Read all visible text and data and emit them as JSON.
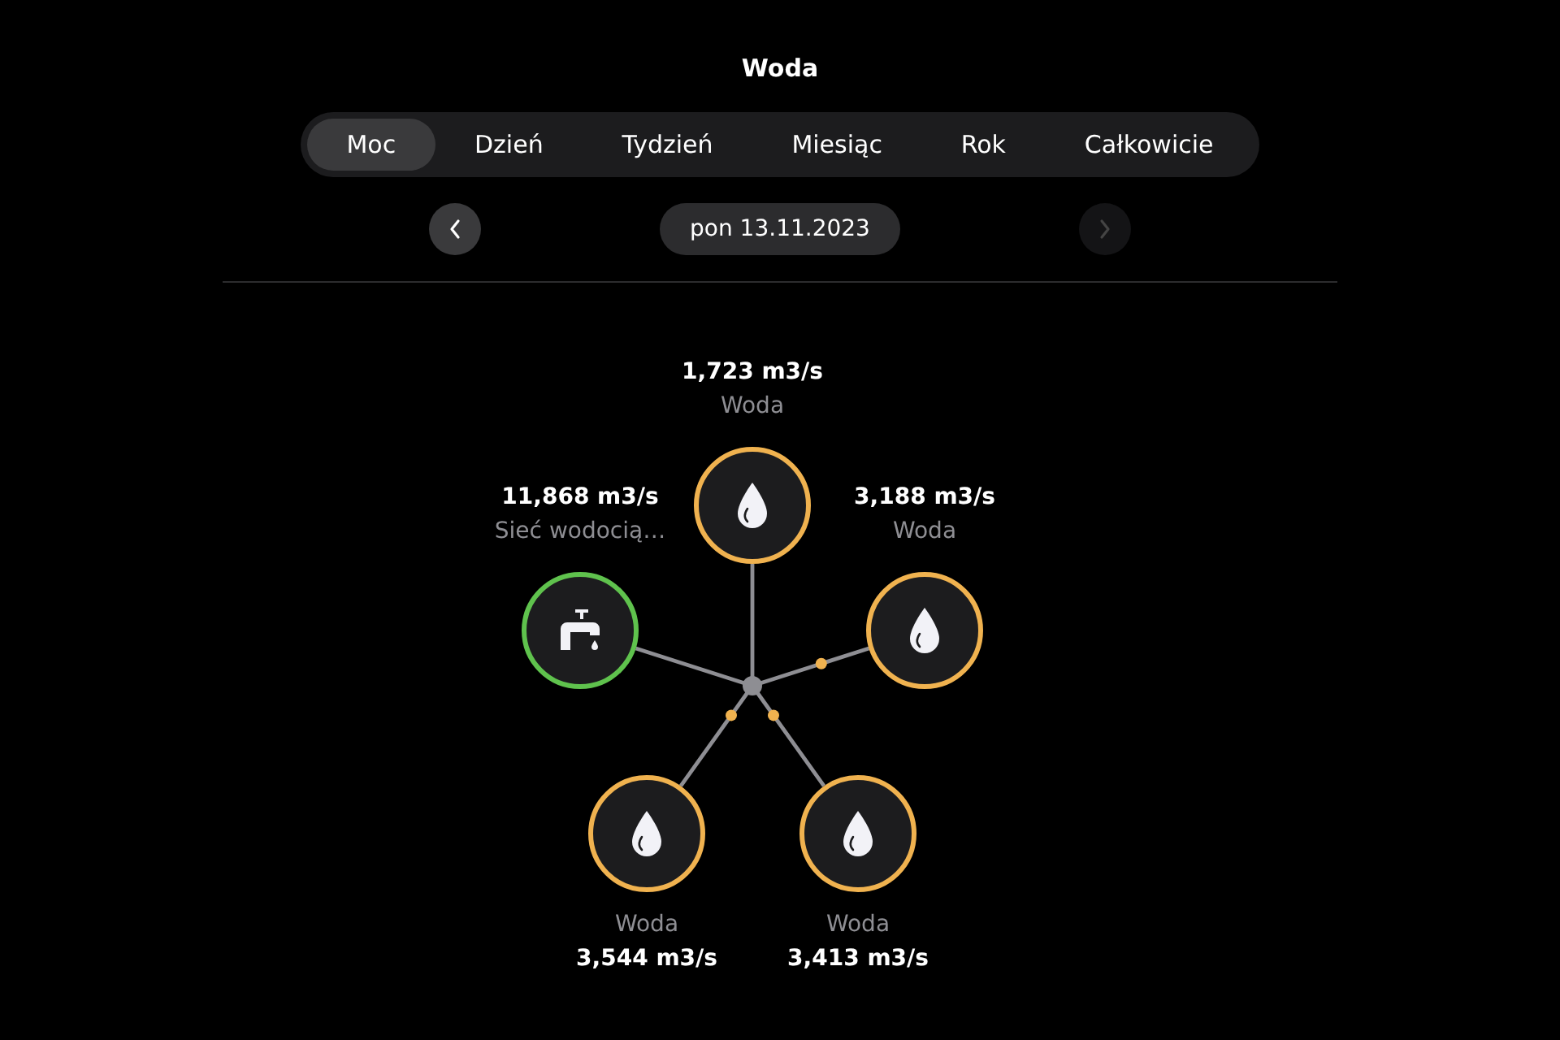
{
  "title": "Woda",
  "tabs": [
    {
      "label": "Moc",
      "selected": true
    },
    {
      "label": "Dzień",
      "selected": false
    },
    {
      "label": "Tydzień",
      "selected": false
    },
    {
      "label": "Miesiąc",
      "selected": false
    },
    {
      "label": "Rok",
      "selected": false
    },
    {
      "label": "Całkowicie",
      "selected": false
    }
  ],
  "date_nav": {
    "date": "pon 13.11.2023",
    "prev_disabled": false,
    "next_disabled": true
  },
  "nodes": [
    {
      "kind": "water",
      "value": "1,723 m3/s",
      "name": "Woda",
      "color": "#f0b24f",
      "flowing": false
    },
    {
      "kind": "tap",
      "value": "11,868 m3/s",
      "name": "Sieć wodocią…",
      "color": "#5fc24d",
      "flowing": false
    },
    {
      "kind": "water",
      "value": "3,188 m3/s",
      "name": "Woda",
      "color": "#f0b24f",
      "flowing": true
    },
    {
      "kind": "water",
      "value": "3,544 m3/s",
      "name": "Woda",
      "color": "#f0b24f",
      "flowing": true
    },
    {
      "kind": "water",
      "value": "3,413 m3/s",
      "name": "Woda",
      "color": "#f0b24f",
      "flowing": true
    }
  ]
}
